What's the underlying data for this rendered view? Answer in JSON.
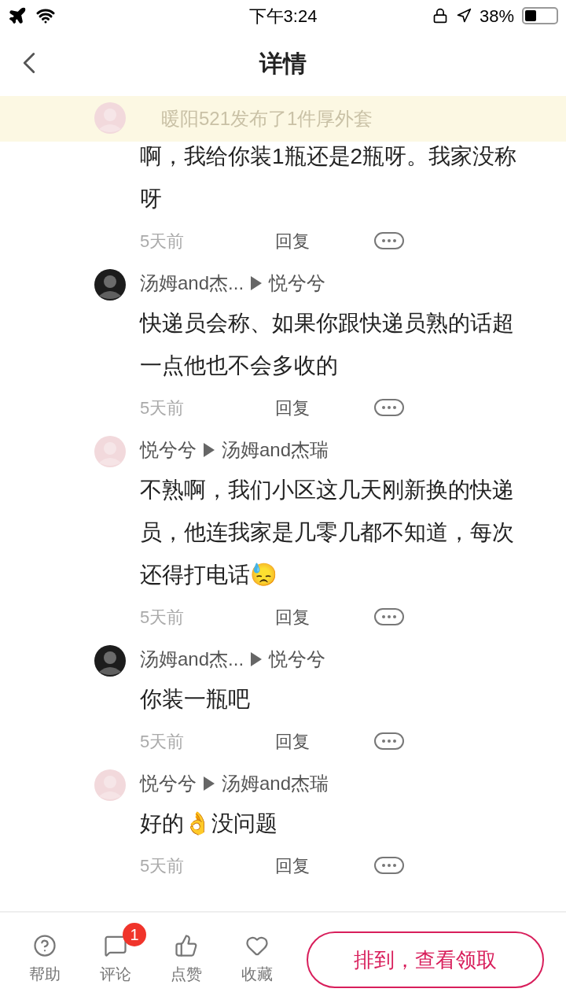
{
  "status_bar": {
    "time": "下午3:24",
    "battery": "38%"
  },
  "nav": {
    "title": "详情"
  },
  "banner": {
    "text": "暖阳521发布了1件厚外套"
  },
  "comments": [
    {
      "color": "#f2d9dc",
      "text": "啊，我给你装1瓶还是2瓶呀。我家没称呀",
      "time": "5天前",
      "reply": "回复"
    },
    {
      "color": "#1c1c1c",
      "author": "汤姆and杰...",
      "reply_to": "悦兮兮",
      "text": "快递员会称、如果你跟快递员熟的话超一点他也不会多收的",
      "time": "5天前",
      "reply": "回复"
    },
    {
      "color": "#f2d9dc",
      "author": "悦兮兮",
      "reply_to": "汤姆and杰瑞",
      "text": "不熟啊，我们小区这几天刚新换的快递员，他连我家是几零几都不知道，每次还得打电话😓",
      "time": "5天前",
      "reply": "回复"
    },
    {
      "color": "#1c1c1c",
      "author": "汤姆and杰...",
      "reply_to": "悦兮兮",
      "text": "你装一瓶吧",
      "time": "5天前",
      "reply": "回复"
    },
    {
      "color": "#f2d9dc",
      "author": "悦兮兮",
      "reply_to": "汤姆and杰瑞",
      "text": "好的👌没问题",
      "time": "5天前",
      "reply": "回复"
    }
  ],
  "bottom_bar": {
    "actions": [
      {
        "kind": "help",
        "label": "帮助"
      },
      {
        "kind": "comment",
        "label": "评论",
        "badge": "1"
      },
      {
        "kind": "like",
        "label": "点赞"
      },
      {
        "kind": "favorite",
        "label": "收藏"
      }
    ],
    "primary_button": "排到，查看领取"
  }
}
